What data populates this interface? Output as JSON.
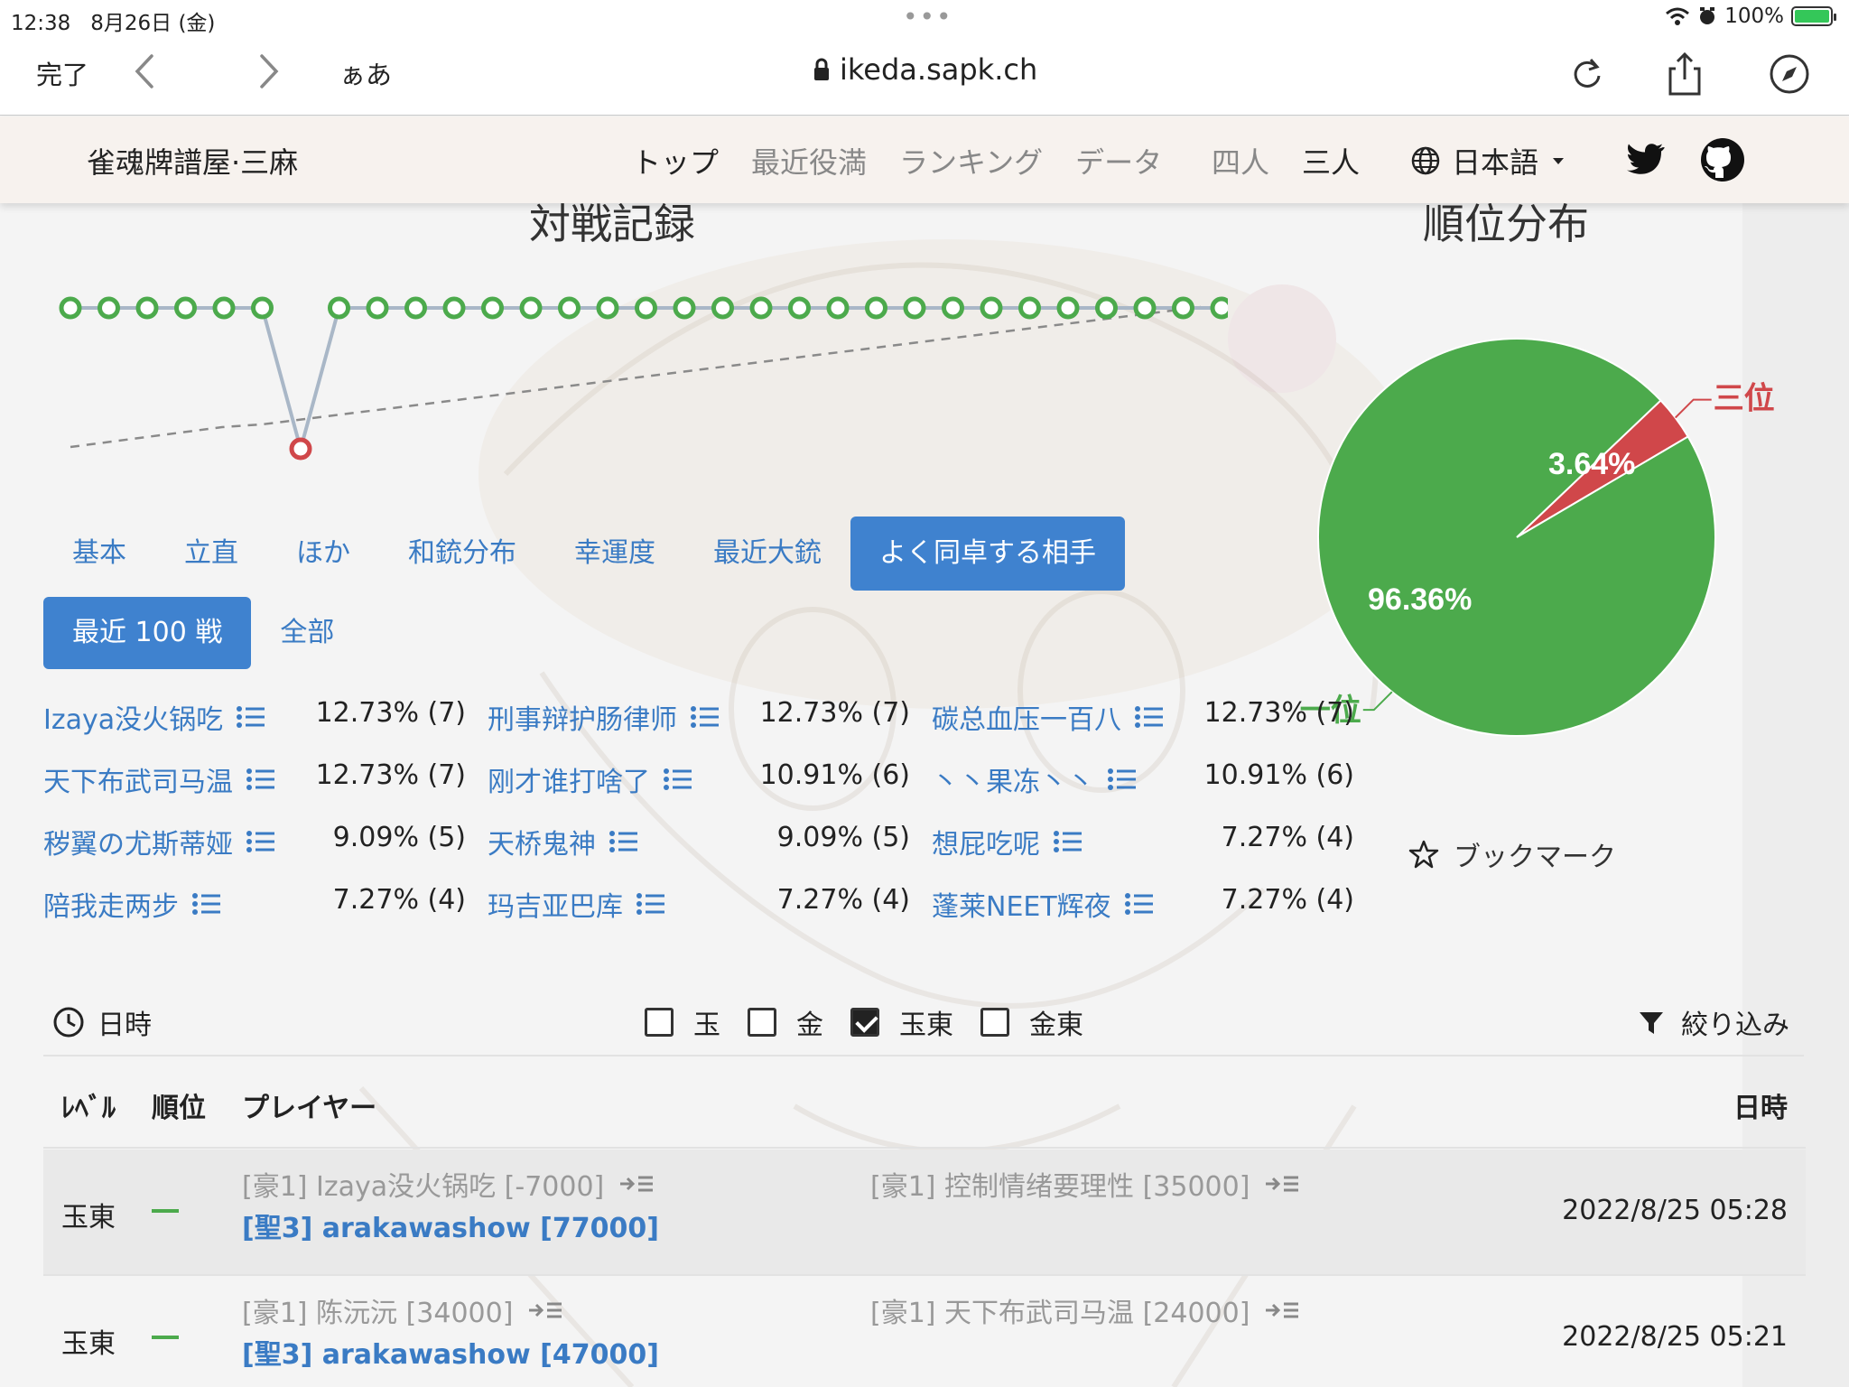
{
  "status": {
    "time": "12:38",
    "date": "8月26日 (金)",
    "battery": "100%"
  },
  "browser": {
    "done": "完了",
    "text_size": "ぁあ",
    "url": "ikeda.sapk.ch"
  },
  "site": {
    "brand": "雀魂牌譜屋·三麻",
    "nav": [
      "トップ",
      "最近役満",
      "ランキング",
      "データ"
    ],
    "modes": [
      "四人",
      "三人"
    ],
    "language": "日本語"
  },
  "headings": {
    "record": "対戦記録",
    "distribution": "順位分布"
  },
  "record_chart": {
    "ranks": [
      1,
      1,
      1,
      1,
      1,
      1,
      3,
      1,
      1,
      1,
      1,
      1,
      1,
      1,
      1,
      1,
      1,
      1,
      1,
      1,
      1,
      1,
      1,
      1,
      1,
      1,
      1,
      1,
      1,
      1,
      1
    ],
    "colors": {
      "first": "#4caa4c",
      "third": "#d0474a",
      "line": "#a9b7c7",
      "trend": "#8a8a8a"
    }
  },
  "chart_data": {
    "type": "pie",
    "title": "順位分布",
    "slices": [
      {
        "label": "一位",
        "value": 96.36,
        "color": "#4caa4c"
      },
      {
        "label": "三位",
        "value": 3.64,
        "color": "#d0474a"
      }
    ],
    "value_labels": [
      "96.36%",
      "3.64%"
    ]
  },
  "tabs": [
    "基本",
    "立直",
    "ほか",
    "和銃分布",
    "幸運度",
    "最近大銃",
    "よく同卓する相手"
  ],
  "active_tab": 6,
  "subtabs": [
    "最近 100 戦",
    "全部"
  ],
  "active_subtab": 0,
  "opponents": [
    {
      "name": "Izaya没火锅吃",
      "pct": "12.73% (7)"
    },
    {
      "name": "刑事辩护肠律师",
      "pct": "12.73% (7)"
    },
    {
      "name": "碳总血压一百八",
      "pct": "12.73% (7)"
    },
    {
      "name": "天下布武司马温",
      "pct": "12.73% (7)"
    },
    {
      "name": "刚才谁打啥了",
      "pct": "10.91% (6)"
    },
    {
      "name": "丶丶果冻丶丶",
      "pct": "10.91% (6)"
    },
    {
      "name": "秽翼の尤斯蒂娅",
      "pct": "9.09% (5)"
    },
    {
      "name": "天桥鬼神",
      "pct": "9.09% (5)"
    },
    {
      "name": "想屁吃呢",
      "pct": "7.27% (4)"
    },
    {
      "name": "陪我走两步",
      "pct": "7.27% (4)"
    },
    {
      "name": "玛吉亚巴库",
      "pct": "7.27% (4)"
    },
    {
      "name": "蓬莱NEET辉夜",
      "pct": "7.27% (4)"
    }
  ],
  "bookmark": "ブックマーク",
  "filter": {
    "datetime": "日時",
    "checks": [
      {
        "label": "玉",
        "checked": false
      },
      {
        "label": "金",
        "checked": false
      },
      {
        "label": "玉東",
        "checked": true
      },
      {
        "label": "金東",
        "checked": false
      }
    ],
    "narrow": "絞り込み"
  },
  "table": {
    "headers": {
      "level": "ﾚﾍﾞﾙ",
      "rank": "順位",
      "player": "プレイヤー",
      "date": "日時"
    },
    "rows": [
      {
        "level": "玉東",
        "p1": "[豪1] Izaya没火锅吃 [-7000]",
        "p2": "[聖3] arakawashow [77000]",
        "p3": "[豪1] 控制情绪要理性 [35000]",
        "date": "2022/8/25 05:28"
      },
      {
        "level": "玉東",
        "p1": "[豪1] 陈沅沅 [34000]",
        "p2": "[聖3] arakawashow [47000]",
        "p3": "[豪1] 天下布武司马温 [24000]",
        "date": "2022/8/25 05:21"
      }
    ]
  }
}
